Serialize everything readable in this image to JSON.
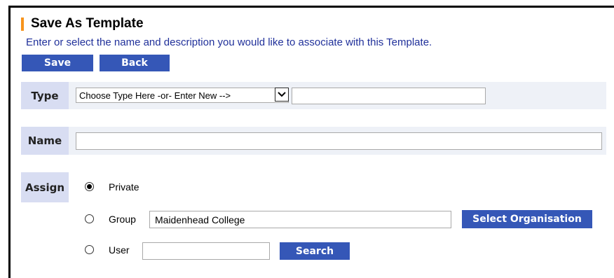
{
  "colors": {
    "accent_bar": "#f7941d",
    "button_bg": "#3557b7",
    "row_bg": "#eef1f7",
    "label_bg": "#d8ddf2",
    "subtitle": "#20309a"
  },
  "header": {
    "title": "Save As Template",
    "subtitle": "Enter or select the name and description you would like to associate with this Template."
  },
  "toolbar": {
    "save_label": "Save",
    "back_label": "Back"
  },
  "form": {
    "type": {
      "label": "Type",
      "select_value": "Choose Type Here -or- Enter New -->",
      "new_type_value": ""
    },
    "name": {
      "label": "Name",
      "value": ""
    },
    "assign": {
      "label": "Assign",
      "options": [
        {
          "label": "Private",
          "selected": true
        },
        {
          "label": "Group",
          "selected": false
        },
        {
          "label": "User",
          "selected": false
        }
      ],
      "group_value": "Maidenhead College",
      "select_organisation_label": "Select Organisation",
      "user_value": "",
      "search_label": "Search"
    }
  },
  "icons": {
    "select_arrow": "chevron-down-icon"
  }
}
